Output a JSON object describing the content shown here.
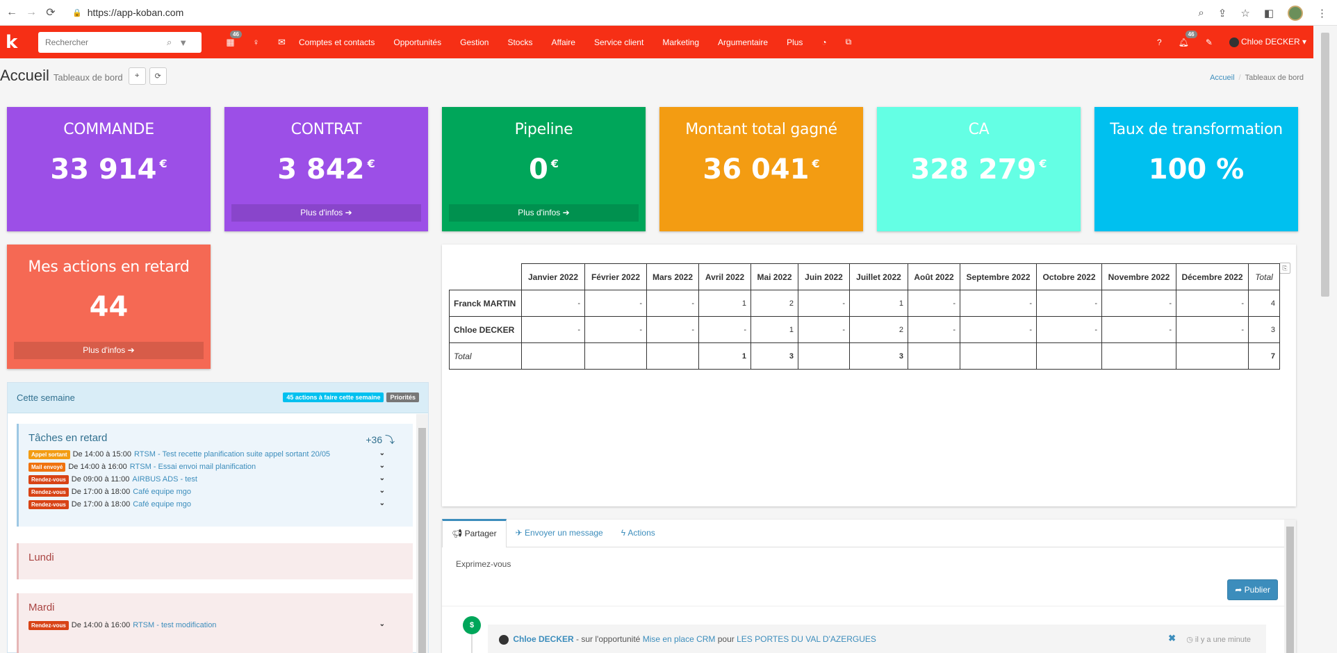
{
  "browser": {
    "url": "https://app-koban.com"
  },
  "appbar": {
    "logo": "k",
    "search_placeholder": "Rechercher",
    "calendar_badge": "46",
    "menu": [
      "Comptes et contacts",
      "Opportunités",
      "Gestion",
      "Stocks",
      "Affaire",
      "Service client",
      "Marketing",
      "Argumentaire",
      "Plus"
    ],
    "notifications_badge": "46",
    "user_name": "Chloe DECKER"
  },
  "header": {
    "title": "Accueil",
    "subtitle": "Tableaux de bord",
    "breadcrumb": [
      "Accueil",
      "Tableaux de bord"
    ]
  },
  "colors": {
    "appbar": "#f62f15",
    "commande": "#9c4fe7",
    "contrat": "#9c4fe7",
    "pipeline": "#00a65a",
    "montant": "#f39c12",
    "ca": "#64ffe4",
    "taux": "#00c0ef",
    "retard": "#f56954"
  },
  "cards": {
    "commande": {
      "title": "COMMANDE",
      "value": "33 914",
      "unit": "€"
    },
    "contrat": {
      "title": "CONTRAT",
      "value": "3 842",
      "unit": "€",
      "more": "Plus d'infos"
    },
    "pipeline": {
      "title": "Pipeline",
      "value": "0",
      "unit": "€",
      "more": "Plus d'infos"
    },
    "montant": {
      "title": "Montant total gagné",
      "value": "36 041",
      "unit": "€"
    },
    "ca": {
      "title": "CA",
      "value": "328 279",
      "unit": "€"
    },
    "taux": {
      "title": "Taux de transformation",
      "value": "100 %"
    },
    "retard": {
      "title": "Mes actions en retard",
      "value": "44",
      "more": "Plus d'infos"
    }
  },
  "table": {
    "columns": [
      "Janvier 2022",
      "Février 2022",
      "Mars 2022",
      "Avril 2022",
      "Mai 2022",
      "Juin 2022",
      "Juillet 2022",
      "Août 2022",
      "Septembre 2022",
      "Octobre 2022",
      "Novembre 2022",
      "Décembre 2022",
      "Total"
    ],
    "rows": [
      {
        "name": "Franck MARTIN",
        "cells": [
          "-",
          "-",
          "-",
          "1",
          "2",
          "-",
          "1",
          "-",
          "-",
          "-",
          "-",
          "-",
          "4"
        ]
      },
      {
        "name": "Chloe DECKER",
        "cells": [
          "-",
          "-",
          "-",
          "-",
          "1",
          "-",
          "2",
          "-",
          "-",
          "-",
          "-",
          "-",
          "3"
        ]
      }
    ],
    "total_row": {
      "name": "Total",
      "cells": [
        "",
        "",
        "",
        "1",
        "3",
        "",
        "3",
        "",
        "",
        "",
        "",
        "",
        "7"
      ]
    }
  },
  "week": {
    "title": "Cette semaine",
    "label_actions": "45 actions à faire cette semaine",
    "label_priorities": "Priorités",
    "late": {
      "title": "Tâches en retard",
      "count": "+36",
      "tasks": [
        {
          "type": "Appel sortant",
          "time": "De 14:00 à 15:00",
          "text": "RTSM - Test recette planification suite appel sortant 20/05"
        },
        {
          "type": "Mail envoyé",
          "time": "De 14:00 à 16:00",
          "text": "RTSM - Essai envoi mail planification"
        },
        {
          "type": "Rendez-vous",
          "time": "De 09:00 à 11:00",
          "text": "AIRBUS ADS - test"
        },
        {
          "type": "Rendez-vous",
          "time": "De 17:00 à 18:00",
          "text": "Café equipe mgo"
        },
        {
          "type": "Rendez-vous",
          "time": "De 17:00 à 18:00",
          "text": "Café equipe mgo"
        }
      ]
    },
    "monday": {
      "title": "Lundi"
    },
    "tuesday": {
      "title": "Mardi",
      "tasks": [
        {
          "type": "Rendez-vous",
          "time": "De 14:00 à 16:00",
          "text": "RTSM - test modification"
        }
      ]
    }
  },
  "share": {
    "tabs": [
      "Partager",
      "Envoyer un message",
      "Actions"
    ],
    "placeholder": "Exprimez-vous",
    "publish": "Publier",
    "feed": {
      "author": "Chloe DECKER",
      "text1": " - sur l'opportunité ",
      "opportunity": "Mise en place CRM",
      "text2": " pour ",
      "company": "LES PORTES DU VAL D'AZERGUES",
      "time": "il y a une minute"
    }
  }
}
